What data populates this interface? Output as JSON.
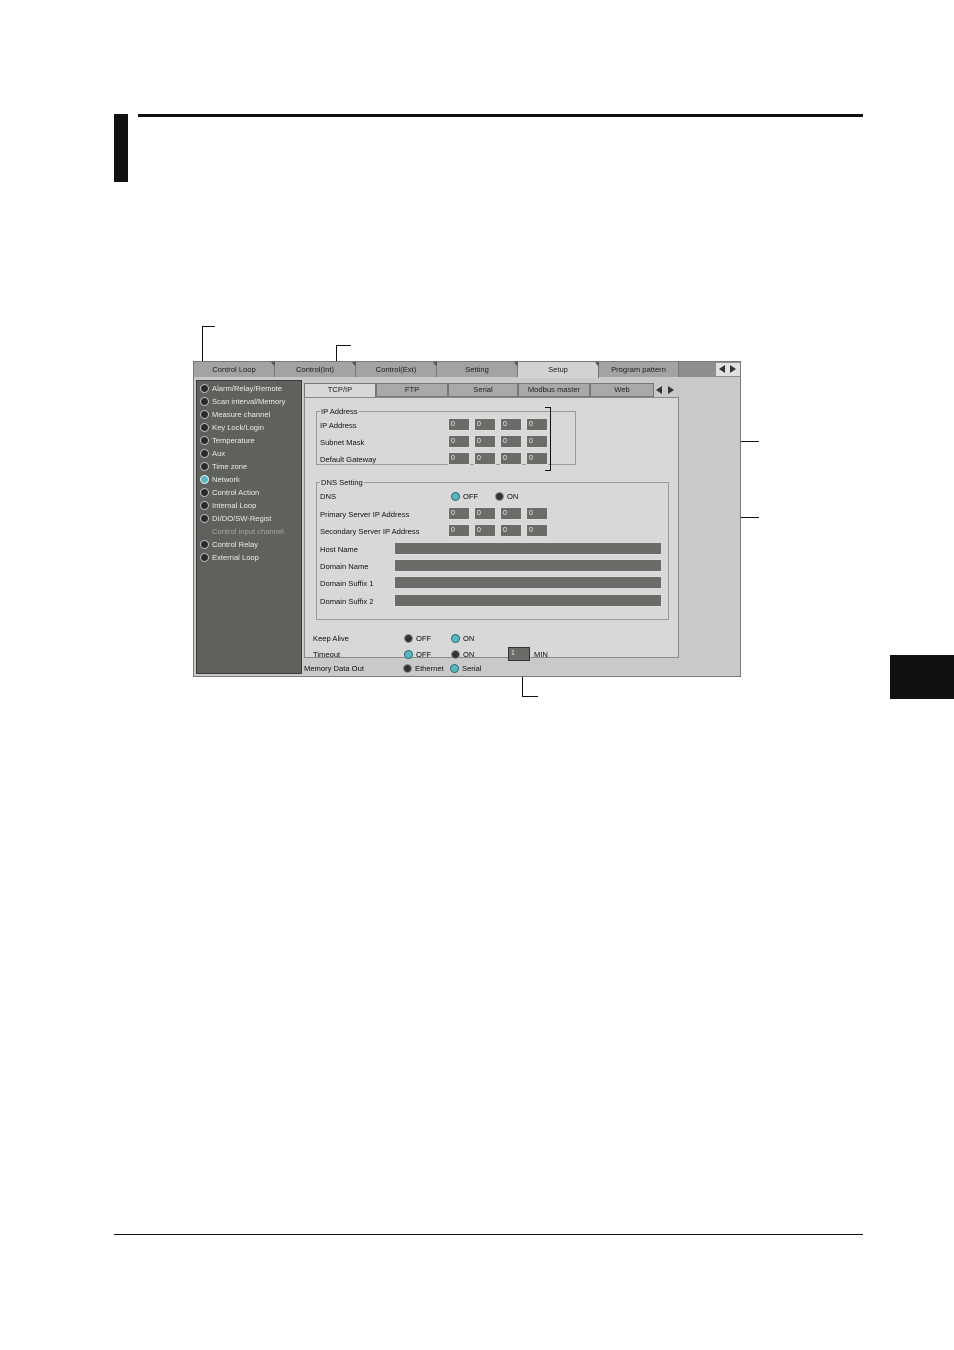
{
  "window": {
    "main_tabs": [
      {
        "label": "Control Loop",
        "active": false
      },
      {
        "label": "Control(Int)",
        "active": false
      },
      {
        "label": "Control(Ext)",
        "active": false
      },
      {
        "label": "Setting",
        "active": false
      },
      {
        "label": "Setup",
        "active": true
      },
      {
        "label": "Program pattern",
        "active": false
      }
    ],
    "sidebar": {
      "items": [
        {
          "label": "Alarm/Relay/Remote",
          "selected": false
        },
        {
          "label": "Scan interval/Memory",
          "selected": false
        },
        {
          "label": "Measure channel",
          "selected": false
        },
        {
          "label": "Key Lock/Login",
          "selected": false
        },
        {
          "label": "Temperature",
          "selected": false
        },
        {
          "label": "Aux",
          "selected": false
        },
        {
          "label": "Time zone",
          "selected": false
        },
        {
          "label": "Network",
          "selected": true
        },
        {
          "label": "Control Action",
          "selected": false
        },
        {
          "label": "Internal Loop",
          "selected": false
        },
        {
          "label": "DI/DO/SW-Regist",
          "selected": false
        },
        {
          "label": "Control input channel",
          "selected": false,
          "disabled": true
        },
        {
          "label": "Control Relay",
          "selected": false
        },
        {
          "label": "External Loop",
          "selected": false
        }
      ]
    },
    "sub_tabs": [
      {
        "label": "TCP/IP",
        "active": true
      },
      {
        "label": "FTP",
        "active": false
      },
      {
        "label": "Serial",
        "active": false
      },
      {
        "label": "Modbus master",
        "active": false
      },
      {
        "label": "Web",
        "active": false
      }
    ],
    "ip_group": {
      "title": "IP Address",
      "rows": [
        {
          "label": "IP Address",
          "octets": [
            "0",
            "0",
            "0",
            "0"
          ]
        },
        {
          "label": "Subnet Mask",
          "octets": [
            "0",
            "0",
            "0",
            "0"
          ]
        },
        {
          "label": "Default Gateway",
          "octets": [
            "0",
            "0",
            "0",
            "0"
          ]
        }
      ]
    },
    "dns_group": {
      "title": "DNS Setting",
      "dns_label": "DNS",
      "dns_off": "OFF",
      "dns_on": "ON",
      "dns_selected": "OFF",
      "servers": [
        {
          "label": "Primary Server IP Address",
          "octets": [
            "0",
            "0",
            "0",
            "0"
          ]
        },
        {
          "label": "Secondary Server IP Address",
          "octets": [
            "0",
            "0",
            "0",
            "0"
          ]
        }
      ],
      "fields": [
        {
          "label": "Host Name",
          "value": ""
        },
        {
          "label": "Domain Name",
          "value": ""
        },
        {
          "label": "Domain Suffix 1",
          "value": ""
        },
        {
          "label": "Domain Suffix 2",
          "value": ""
        }
      ]
    },
    "keep_alive": {
      "label": "Keep Alive",
      "off": "OFF",
      "on": "ON",
      "selected": "ON"
    },
    "timeout": {
      "label": "Timeout",
      "off": "OFF",
      "on": "ON",
      "selected": "OFF",
      "value": "1",
      "unit": "MIN"
    },
    "memory_data_out": {
      "label": "Memory Data Out",
      "opt1": "Ethernet",
      "opt2": "Serial",
      "selected": "Serial"
    },
    "colors": {
      "led_on": "#59b7c0",
      "sidebar_bg": "#5f615c",
      "field_bg": "#6a6c67"
    }
  }
}
